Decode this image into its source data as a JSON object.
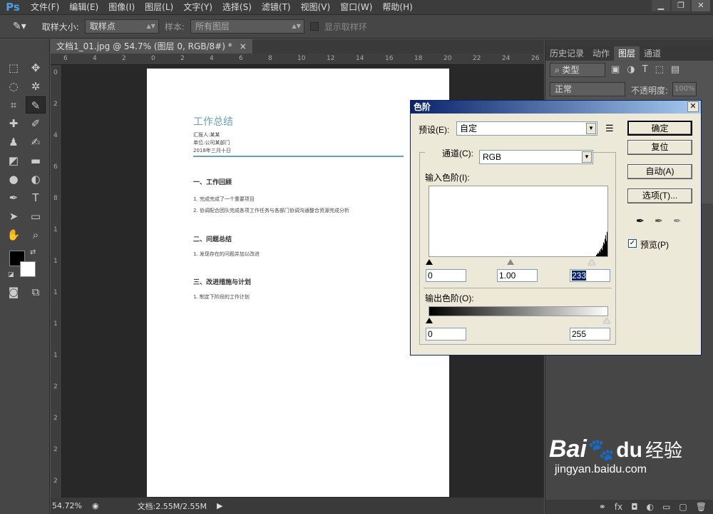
{
  "app": {
    "logo": "Ps"
  },
  "menu": [
    "文件(F)",
    "编辑(E)",
    "图像(I)",
    "图层(L)",
    "文字(Y)",
    "选择(S)",
    "滤镜(T)",
    "视图(V)",
    "窗口(W)",
    "帮助(H)"
  ],
  "options": {
    "sample_size_label": "取样大小:",
    "sample_size_value": "取样点",
    "sample_label": "样本:",
    "sample_value": "所有图层",
    "show_ring_label": "显示取样环"
  },
  "document": {
    "tab_title": "文档1_01.jpg @ 54.7% (图层 0, RGB/8#) *",
    "close": "×",
    "zoom": "54.72%",
    "doc_info": "文档:2.55M/2.55M"
  },
  "ruler_h": [
    "6",
    "4",
    "2",
    "0",
    "2",
    "4",
    "6",
    "8",
    "10",
    "12",
    "14",
    "16",
    "18",
    "20",
    "22",
    "24",
    "26"
  ],
  "ruler_v": [
    "0",
    "2",
    "4",
    "6",
    "8",
    "1",
    "1",
    "1",
    "1",
    "1",
    "2",
    "2",
    "2",
    "2"
  ],
  "page": {
    "title": "工作总结",
    "meta": [
      "汇报人:某某",
      "单位:公司某部门",
      "2018年三月十日"
    ],
    "s1": "一、工作回顾",
    "s1_items": [
      "1. 完成完成了一个重要项目",
      "2. 协调配合团队完成各项工作任务与各部门协调沟通整合资源完成分析"
    ],
    "s2": "二、问题总结",
    "s2_items": [
      "1. 发现存在的问题并加以改进"
    ],
    "s3": "三、改进措施与计划",
    "s3_items": [
      "1. 制定下阶段的工作计划"
    ]
  },
  "panel": {
    "tabs": [
      "历史记录",
      "动作",
      "图层",
      "通道"
    ],
    "kind": "类型",
    "blend": "正常",
    "opacity_label": "不透明度:",
    "opacity_value": "100%"
  },
  "levels_dialog": {
    "title": "色阶",
    "close": "✕",
    "preset_label": "预设(E):",
    "preset_value": "自定",
    "channel_label": "通道(C):",
    "channel_value": "RGB",
    "input_label": "输入色阶(I):",
    "input_black": "0",
    "input_gamma": "1.00",
    "input_white": "233",
    "output_label": "输出色阶(O):",
    "output_black": "0",
    "output_white": "255",
    "ok": "确定",
    "reset": "复位",
    "auto": "自动(A)",
    "options": "选项(T)...",
    "preview_label": "预览(P)",
    "preview_checked": true,
    "histogram": [
      0,
      0,
      0,
      0,
      0,
      0,
      0,
      0,
      0,
      0,
      0,
      0,
      0,
      0,
      0,
      0,
      0,
      0,
      0,
      0,
      0,
      0,
      0,
      0,
      0,
      0,
      0,
      0,
      0,
      0,
      0,
      0,
      0,
      0,
      0,
      0,
      0,
      0,
      0,
      0,
      0,
      0,
      0,
      0,
      0,
      0,
      0,
      0,
      0,
      0,
      0,
      0,
      0,
      0,
      0,
      0,
      0,
      0,
      0,
      0,
      0,
      0,
      0,
      0,
      0,
      0,
      0,
      0,
      0,
      0,
      0,
      0,
      0,
      0,
      0,
      0,
      0,
      0,
      0,
      0,
      0,
      0,
      0,
      0,
      0,
      0,
      0,
      0,
      0,
      0,
      0,
      0,
      0,
      0,
      0,
      0,
      0,
      0,
      0,
      0,
      0,
      0,
      0,
      0,
      0,
      0,
      0,
      0,
      0,
      0,
      0,
      0,
      0,
      0,
      0,
      0,
      0,
      0,
      0,
      0,
      0,
      0,
      0,
      0,
      0,
      0,
      0,
      0,
      0,
      0,
      0,
      0,
      0,
      0,
      0,
      0,
      0,
      0,
      0,
      0,
      0,
      0,
      0,
      0,
      0,
      0,
      0,
      0,
      0,
      0,
      0,
      0,
      0,
      0,
      0,
      0,
      0,
      0,
      0,
      0,
      0,
      0,
      0,
      0,
      0,
      0,
      0,
      0,
      0,
      0,
      0,
      0,
      0,
      0,
      0,
      0,
      0,
      0,
      0,
      0,
      0,
      0,
      0,
      0,
      0,
      0,
      0,
      0,
      0,
      0,
      0,
      0,
      0,
      0,
      0,
      0,
      0,
      0,
      0,
      0,
      0,
      0,
      0,
      0,
      0,
      0,
      0,
      0,
      0,
      0,
      0,
      0,
      0,
      0,
      0,
      0,
      0,
      0,
      0,
      0,
      0,
      0,
      0,
      0,
      0,
      0,
      0,
      0,
      0,
      0,
      0,
      0,
      0,
      0,
      0,
      0.02,
      0.03,
      0.05,
      0.04,
      0.08,
      0.06,
      0.1,
      0.12,
      0.09,
      0.15,
      0.2,
      0.18,
      0.25,
      0.3,
      0.22,
      0.35
    ]
  },
  "watermark": {
    "brand": "Bai",
    "paw": "du",
    "cn": "经验",
    "url": "jingyan.baidu.com"
  }
}
